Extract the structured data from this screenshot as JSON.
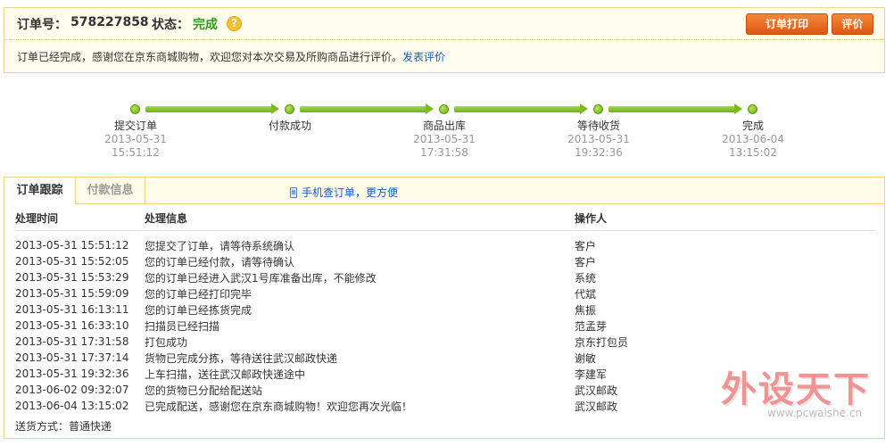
{
  "status": {
    "order_label": "订单号：",
    "order_no": "578227858",
    "state_label": "状态：",
    "state_value": "完成",
    "help_icon": "?",
    "print_button": "订单打印",
    "review_button": "评价",
    "message": "订单已经完成，感谢您在京东商城购物，欢迎您对本次交易及所购商品进行评价。",
    "message_link": "发表评价",
    "colors": {
      "state": "#2f9a1a",
      "button": "#e0560f",
      "link": "#1a5bb8"
    }
  },
  "progress": {
    "steps": [
      {
        "name": "提交订单",
        "date": "2013-05-31",
        "time": "15:51:12"
      },
      {
        "name": "付款成功",
        "date": "",
        "time": ""
      },
      {
        "name": "商品出库",
        "date": "2013-05-31",
        "time": "17:31:58"
      },
      {
        "name": "等待收货",
        "date": "2013-05-31",
        "time": "19:32:36"
      },
      {
        "name": "完成",
        "date": "2013-06-04",
        "time": "13:15:02"
      }
    ]
  },
  "tracking": {
    "tabs": [
      "订单跟踪",
      "付款信息"
    ],
    "mobile_link": "手机查订单，更方便",
    "headers": [
      "处理时间",
      "处理信息",
      "操作人"
    ],
    "rows": [
      [
        "2013-05-31 15:51:12",
        "您提交了订单，请等待系统确认",
        "客户"
      ],
      [
        "2013-05-31 15:52:05",
        "您的订单已经付款，请等待确认",
        "客户"
      ],
      [
        "2013-05-31 15:53:29",
        "您的订单已经进入武汉1号库准备出库，不能修改",
        "系统"
      ],
      [
        "2013-05-31 15:59:09",
        "您的订单已经打印完毕",
        "代斌"
      ],
      [
        "2013-05-31 16:13:11",
        "您的订单已经拣货完成",
        "焦振"
      ],
      [
        "2013-05-31 16:33:10",
        "扫描员已经扫描",
        "范孟芽"
      ],
      [
        "2013-05-31 17:31:58",
        "打包成功",
        "京东打包员"
      ],
      [
        "2013-05-31 17:37:14",
        "货物已完成分拣，等待送往武汉邮政快递",
        "谢敏"
      ],
      [
        "2013-05-31 19:32:36",
        "上车扫描，送往武汉邮政快递途中",
        "李建军"
      ],
      [
        "2013-06-02 09:32:07",
        "您的货物已分配给配送站",
        "武汉邮政"
      ],
      [
        "2013-06-04 13:15:02",
        "已完成配送，感谢您在京东商城购物！欢迎您再次光临！",
        "武汉邮政"
      ]
    ],
    "shipping": "送货方式：普通快递"
  },
  "watermark": {
    "main": "外设天下",
    "sub": "www.pcwaishe.cn"
  }
}
